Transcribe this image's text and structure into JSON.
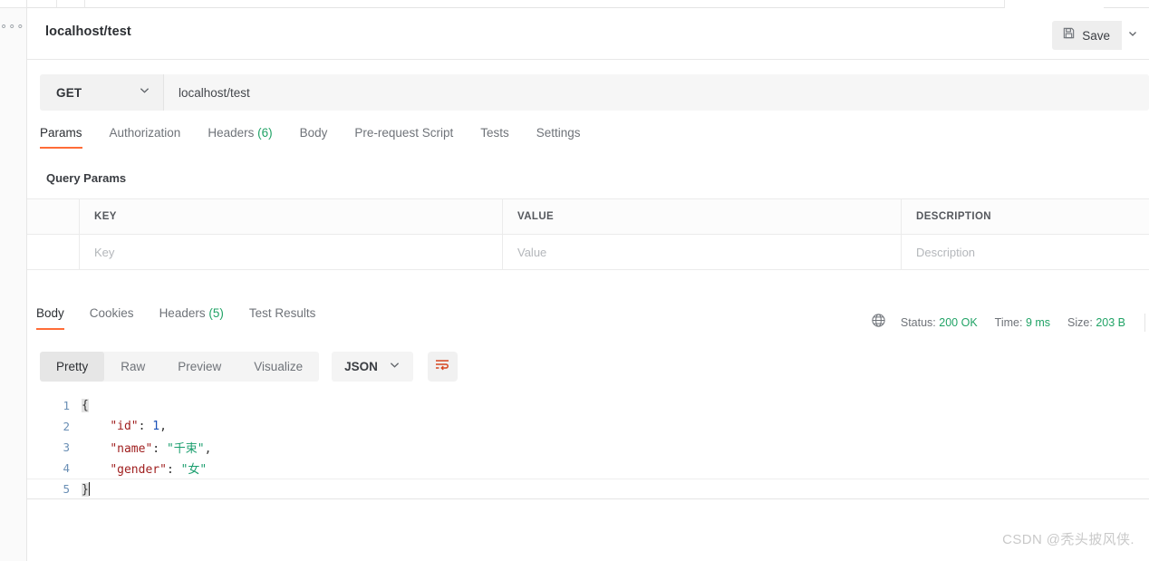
{
  "sidebar": {
    "more_icon": "ellipsis-icon"
  },
  "header": {
    "request_title": "localhost/test",
    "save_label": "Save",
    "save_icon": "floppy-disk-icon",
    "save_caret_icon": "chevron-down-icon"
  },
  "url_bar": {
    "method": "GET",
    "method_caret_icon": "chevron-down-icon",
    "url": "localhost/test"
  },
  "request_tabs": [
    {
      "label": "Params",
      "count": "",
      "active": true
    },
    {
      "label": "Authorization",
      "count": "",
      "active": false
    },
    {
      "label": "Headers",
      "count": "(6)",
      "active": false
    },
    {
      "label": "Body",
      "count": "",
      "active": false
    },
    {
      "label": "Pre-request Script",
      "count": "",
      "active": false
    },
    {
      "label": "Tests",
      "count": "",
      "active": false
    },
    {
      "label": "Settings",
      "count": "",
      "active": false
    }
  ],
  "params": {
    "section_label": "Query Params",
    "columns": [
      "KEY",
      "VALUE",
      "DESCRIPTION"
    ],
    "rows": [
      {
        "key_placeholder": "Key",
        "value_placeholder": "Value",
        "description_placeholder": "Description"
      }
    ]
  },
  "response_tabs": [
    {
      "label": "Body",
      "count": "",
      "active": true
    },
    {
      "label": "Cookies",
      "count": "",
      "active": false
    },
    {
      "label": "Headers",
      "count": "(5)",
      "active": false
    },
    {
      "label": "Test Results",
      "count": "",
      "active": false
    }
  ],
  "response_meta": {
    "globe_icon": "globe-icon",
    "status_label": "Status:",
    "status_value": "200 OK",
    "time_label": "Time:",
    "time_value": "9 ms",
    "size_label": "Size:",
    "size_value": "203 B"
  },
  "format_bar": {
    "views": [
      {
        "label": "Pretty",
        "active": true
      },
      {
        "label": "Raw",
        "active": false
      },
      {
        "label": "Preview",
        "active": false
      },
      {
        "label": "Visualize",
        "active": false
      }
    ],
    "language": "JSON",
    "language_caret_icon": "chevron-down-icon",
    "wrap_icon": "word-wrap-icon"
  },
  "response_body": {
    "line_numbers": [
      "1",
      "2",
      "3",
      "4",
      "5"
    ],
    "lines": [
      {
        "indent": "",
        "open_brace": "{"
      },
      {
        "indent": "    ",
        "key": "\"id\"",
        "colon": ": ",
        "num": "1",
        "comma": ","
      },
      {
        "indent": "    ",
        "key": "\"name\"",
        "colon": ": ",
        "str": "\"千束\"",
        "comma": ","
      },
      {
        "indent": "    ",
        "key": "\"gender\"",
        "colon": ": ",
        "str": "\"女\"",
        "comma": ""
      },
      {
        "indent": "",
        "close_brace": "}"
      }
    ]
  },
  "watermark": {
    "text": "CSDN @秃头披风侠."
  },
  "colors": {
    "accent": "#ff6c37",
    "success": "#21a366",
    "json_key": "#a02020",
    "json_string": "#1a9e6e",
    "json_number": "#1b52b8",
    "gutter": "#6a8fb5"
  }
}
